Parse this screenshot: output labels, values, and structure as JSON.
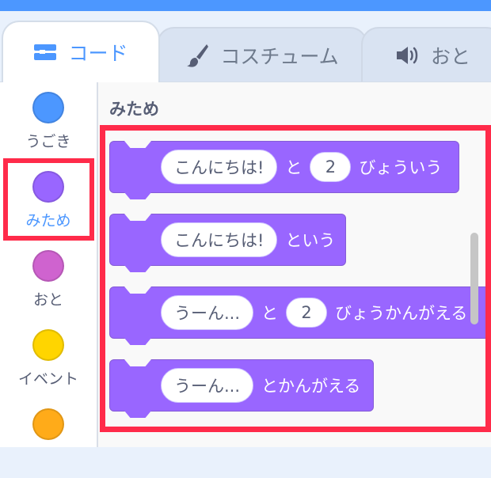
{
  "tabs": [
    {
      "label": "コード",
      "icon": "code-blocks-icon",
      "active": true
    },
    {
      "label": "コスチューム",
      "icon": "paintbrush-icon",
      "active": false
    },
    {
      "label": "おと",
      "icon": "speaker-icon",
      "active": false
    }
  ],
  "categories": [
    {
      "label": "うごき",
      "color": "#4c97ff"
    },
    {
      "label": "みため",
      "color": "#9966ff",
      "selected": true
    },
    {
      "label": "おと",
      "color": "#cf63cf"
    },
    {
      "label": "イベント",
      "color": "#ffd500"
    },
    {
      "label": "",
      "color": "#ffab19"
    }
  ],
  "palette": {
    "heading": "みため",
    "blocks": [
      {
        "input1": "こんにちは!",
        "text1": "と",
        "input2": "2",
        "text2": "びょういう"
      },
      {
        "input1": "こんにちは!",
        "text1": "という"
      },
      {
        "input1": "うーん...",
        "text1": "と",
        "input2": "2",
        "text2": "びょうかんがえる"
      },
      {
        "input1": "うーん...",
        "text1": "とかんがえる"
      }
    ]
  },
  "colors": {
    "accent": "#4c97ff",
    "looks": "#9966ff",
    "highlight": "#ff2b4a"
  }
}
